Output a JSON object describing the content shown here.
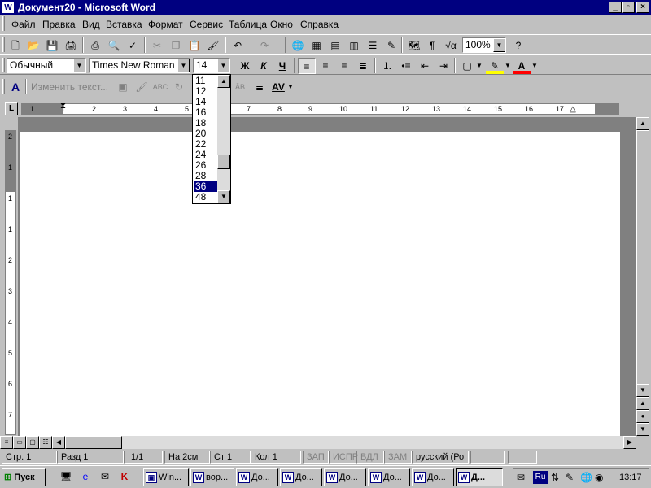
{
  "window": {
    "title": "Документ20 - Microsoft Word",
    "app_icon": "word-icon",
    "min": "_",
    "max": "▫",
    "close": "×"
  },
  "menu": [
    "Файл",
    "Правка",
    "Вид",
    "Вставка",
    "Формат",
    "Сервис",
    "Таблица",
    "Окно",
    "Справка"
  ],
  "standard_toolbar": {
    "zoom": "100%"
  },
  "format_toolbar": {
    "style": "Обычный",
    "font": "Times New Roman",
    "size": "14",
    "bold": "Ж",
    "italic": "К",
    "underline": "Ч"
  },
  "wordart_toolbar": {
    "edit_text": "Изменить текст...",
    "spacing": "AV"
  },
  "font_size_dropdown": {
    "options": [
      "11",
      "12",
      "14",
      "16",
      "18",
      "20",
      "22",
      "24",
      "26",
      "28",
      "36",
      "48"
    ],
    "selected": "36"
  },
  "ruler": {
    "labels": [
      "1",
      "1",
      "2",
      "3",
      "4",
      "5",
      "6",
      "7",
      "8",
      "9",
      "10",
      "11",
      "12",
      "13",
      "14",
      "15",
      "16",
      "17"
    ],
    "vlabels": [
      "2",
      "1",
      "1",
      "1",
      "2",
      "3",
      "4",
      "5",
      "6",
      "7"
    ]
  },
  "status": {
    "page": "Стр. 1",
    "section": "Разд 1",
    "pages": "1/1",
    "at": "На 2см",
    "line": "Ст 1",
    "col": "Кол 1",
    "rec": "ЗАП",
    "trk": "ИСПР",
    "ext": "ВДЛ",
    "ovr": "ЗАМ",
    "lang": "русский (Ро"
  },
  "taskbar": {
    "start": "Пуск",
    "tasks": [
      "Win...",
      "вор...",
      "До...",
      "До...",
      "До...",
      "До...",
      "До...",
      "Д..."
    ],
    "tray_lang": "Ru",
    "clock": "13:17"
  },
  "colors": {
    "title_bg": "#000080",
    "face": "#c0c0c0",
    "highlight": "#ffff00",
    "font_color": "#ff0000"
  }
}
